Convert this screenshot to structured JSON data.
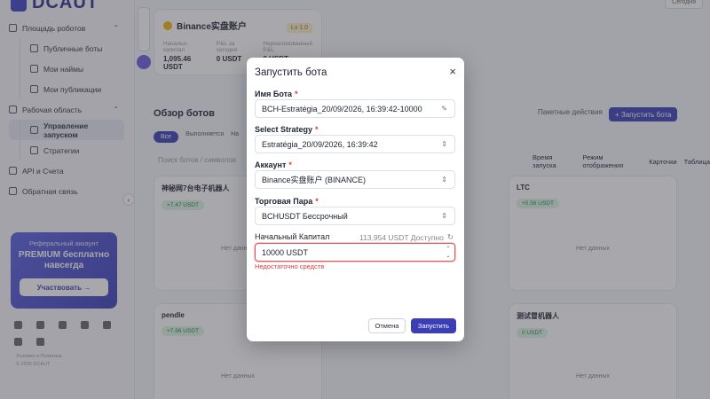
{
  "sidebar": {
    "logo": "DCAUT",
    "items": [
      {
        "label": "Площадь роботов",
        "type": "group"
      },
      {
        "label": "Публичные боты",
        "type": "sub"
      },
      {
        "label": "Мои наймы",
        "type": "sub"
      },
      {
        "label": "Мои публикации",
        "type": "sub"
      },
      {
        "label": "Рабочая область",
        "type": "group"
      },
      {
        "label": "Управление запуском",
        "type": "sub",
        "active": true
      },
      {
        "label": "Стратегии",
        "type": "sub"
      },
      {
        "label": "API и Счета",
        "type": "item"
      },
      {
        "label": "Обратная связь",
        "type": "item"
      }
    ],
    "promo": {
      "line1": "Реферальный аккаунт",
      "line2": "PREMIUM бесплатно навсегда",
      "button": "Участвовать →"
    },
    "footer": [
      "Условия и Политика",
      "© 2025 DCAUT"
    ]
  },
  "account_card": {
    "name": "Binance实盘账户",
    "badge": "Lv 1.0",
    "stats": [
      {
        "label": "Начальн. капитал",
        "value": "1,095.46 USDT"
      },
      {
        "label": "P&L за сегодня",
        "value": "0 USDT"
      },
      {
        "label": "Нереализованный P&L",
        "value": "0 USDT"
      }
    ]
  },
  "top_buttons": [
    "Сегодня"
  ],
  "overview": {
    "title": "Обзор ботов",
    "bulk_actions": "Пакетные действия",
    "launch_button": "+ Запустить бота",
    "tabs": [
      "Все",
      "Выполняется",
      "На"
    ],
    "search_placeholder": "Поиск ботов / символов",
    "sort_label": "Время запуска",
    "view_label": "Режим отображения",
    "view_cards": "Карточки",
    "view_table": "Таблица"
  },
  "bot_cards": [
    {
      "title": "神秘网7台电子机器人",
      "pill": "+7.47 USDT",
      "status": "Нет данных"
    },
    {
      "title": "LTC",
      "pill": "+0.56 USDT",
      "status": "Нет данных"
    },
    {
      "title": "pendle",
      "pill": "+7.96 USDT",
      "status": "Нет данных"
    },
    {
      "title": "测试冒机器人",
      "pill": "0 USDT",
      "status": "Нет данных"
    }
  ],
  "modal": {
    "title": "Запустить бота",
    "close": "×",
    "fields": {
      "bot_name": {
        "label": "Имя Бота",
        "value": "BCH-Estratégia_20/09/2026, 16:39:42-10000"
      },
      "strategy": {
        "label": "Select Strategy",
        "value": "Estratégia_20/09/2026, 16:39:42"
      },
      "account": {
        "label": "Аккаунт",
        "value": "Binance实盘账户 (BINANCE)"
      },
      "pair": {
        "label": "Торговая Пара",
        "value": "BCHUSDT Бессрочный"
      },
      "capital": {
        "label": "Начальный Капитал",
        "value": "10000 USDT",
        "available": "113,954 USDT Доступно"
      }
    },
    "error": "Недостаточно средств",
    "cancel": "Отмена",
    "submit": "Запустить"
  }
}
